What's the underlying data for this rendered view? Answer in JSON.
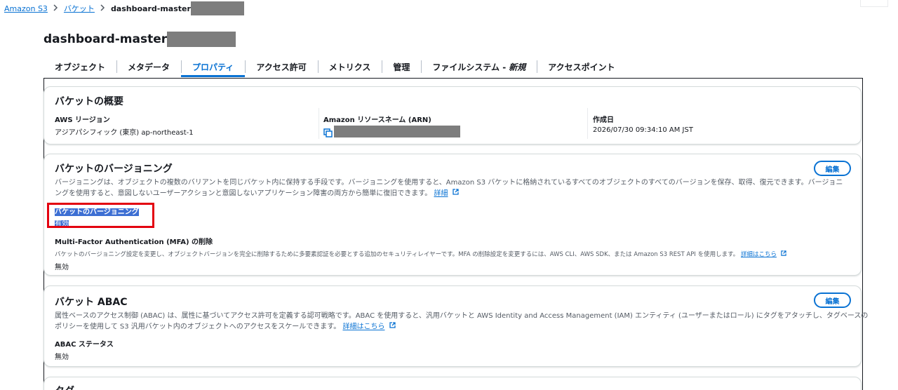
{
  "breadcrumb": {
    "items": [
      "Amazon S3",
      "バケット"
    ],
    "current": "dashboard-master"
  },
  "page": {
    "title": "dashboard-master"
  },
  "tabs": [
    {
      "label": "オブジェクト",
      "suffix": ""
    },
    {
      "label": "メタデータ",
      "suffix": ""
    },
    {
      "label": "プロパティ",
      "suffix": ""
    },
    {
      "label": "アクセス許可",
      "suffix": ""
    },
    {
      "label": "メトリクス",
      "suffix": ""
    },
    {
      "label": "管理",
      "suffix": ""
    },
    {
      "label": "ファイルシステム -",
      "suffix": "新規"
    },
    {
      "label": "アクセスポイント",
      "suffix": ""
    }
  ],
  "overview": {
    "title": "バケットの概要",
    "region_label": "AWS リージョン",
    "region_value": "アジアパシフィック (東京) ap-northeast-1",
    "arn_label": "Amazon リソースネーム (ARN)",
    "created_label": "作成日",
    "created_value": "2026/07/30 09:34:10 AM JST"
  },
  "versioning": {
    "title": "バケットのバージョニング",
    "edit_label": "編集",
    "desc_line1": "バージョニングは、オブジェクトの複数のバリアントを同じバケット内に保持する手段です。バージョニングを使用すると、Amazon S3 バケットに格納されているすべてのオブジェクトのすべてのバージョンを保存、取得、復元できます。バージョニ",
    "desc_line2": "ングを使用すると、意図しないユーザーアクションと意図しないアプリケーション障害の両方から簡単に復旧できます。",
    "learn_more": "詳細",
    "status_label": "バケットのバージョニング",
    "status_value": "有効",
    "mfa_label": "Multi-Factor Authentication (MFA) の削除",
    "mfa_desc": "バケットのバージョニング設定を変更し、オブジェクトバージョンを完全に削除するために多要素認証を必要とする追加のセキュリティレイヤーです。MFA の削除設定を変更するには、AWS CLI、AWS SDK、または Amazon S3 REST API を使用します。",
    "mfa_link": "詳細はこちら",
    "mfa_value": "無効"
  },
  "abac": {
    "title": "バケット ABAC",
    "edit_label": "編集",
    "desc_line1": "属性ベースのアクセス制御 (ABAC) は、属性に基づいてアクセス許可を定義する認可戦略です。ABAC を使用すると、汎用バケットと AWS Identity and Access Management (IAM) エンティティ (ユーザーまたはロール) にタグをアタッチし、タグベースの",
    "desc_line2": "ポリシーを使用して S3 汎用バケット内のオブジェクトへのアクセスをスケールできます。",
    "learn_more": "詳細はこちら",
    "status_label": "ABAC ステータス",
    "status_value": "無効"
  },
  "tags": {
    "title": "タグ"
  },
  "colors": {
    "link": "#0972d3",
    "highlight": "#3d6fd3",
    "annotation": "#e3000f"
  }
}
